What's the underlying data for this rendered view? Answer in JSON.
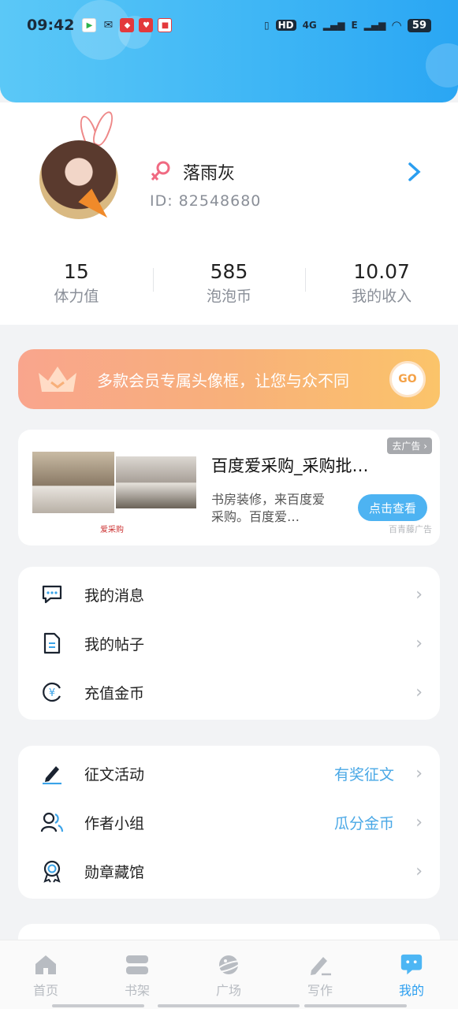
{
  "status_bar": {
    "time": "09:42",
    "signal_text_1": "4G",
    "signal_text_2": "E",
    "battery": "59",
    "hd": "HD"
  },
  "profile": {
    "username": "落雨灰",
    "user_id": "ID:  82548680",
    "stats": [
      {
        "value": "15",
        "label": "体力值"
      },
      {
        "value": "585",
        "label": "泡泡币"
      },
      {
        "value": "10.07",
        "label": "我的收入"
      }
    ]
  },
  "vip_banner": {
    "text": "多款会员专属头像框，让您与众不同",
    "go_label": "GO"
  },
  "ad": {
    "tag": "去广告",
    "title": "百度爱采购_采购批…",
    "description": "书房装修，来百度爱采购。百度爱…",
    "button": "点击查看",
    "source": "百青藤广告",
    "logo": "爱采购"
  },
  "menu_group_1": [
    {
      "label": "我的消息",
      "icon": "message-icon"
    },
    {
      "label": "我的帖子",
      "icon": "document-icon"
    },
    {
      "label": "充值金币",
      "icon": "yuan-coin-icon"
    }
  ],
  "menu_group_2": [
    {
      "label": "征文活动",
      "extra": "有奖征文",
      "icon": "pen-icon"
    },
    {
      "label": "作者小组",
      "extra": "瓜分金币",
      "icon": "group-icon"
    },
    {
      "label": "勋章藏馆",
      "extra": "",
      "icon": "medal-icon"
    }
  ],
  "tabbar": [
    {
      "label": "首页",
      "icon": "home-icon"
    },
    {
      "label": "书架",
      "icon": "bookshelf-icon"
    },
    {
      "label": "广场",
      "icon": "planet-icon"
    },
    {
      "label": "写作",
      "icon": "write-icon"
    },
    {
      "label": "我的",
      "icon": "chat-bubble-icon",
      "active": true
    }
  ],
  "colors": {
    "accent": "#2a9ef0",
    "header_gradient_start": "#5bc8f7",
    "header_gradient_end": "#2aa6f3",
    "vip_gradient_start": "#f9a58d",
    "vip_gradient_end": "#fbc46a",
    "link_blue": "#4aa8e6"
  }
}
